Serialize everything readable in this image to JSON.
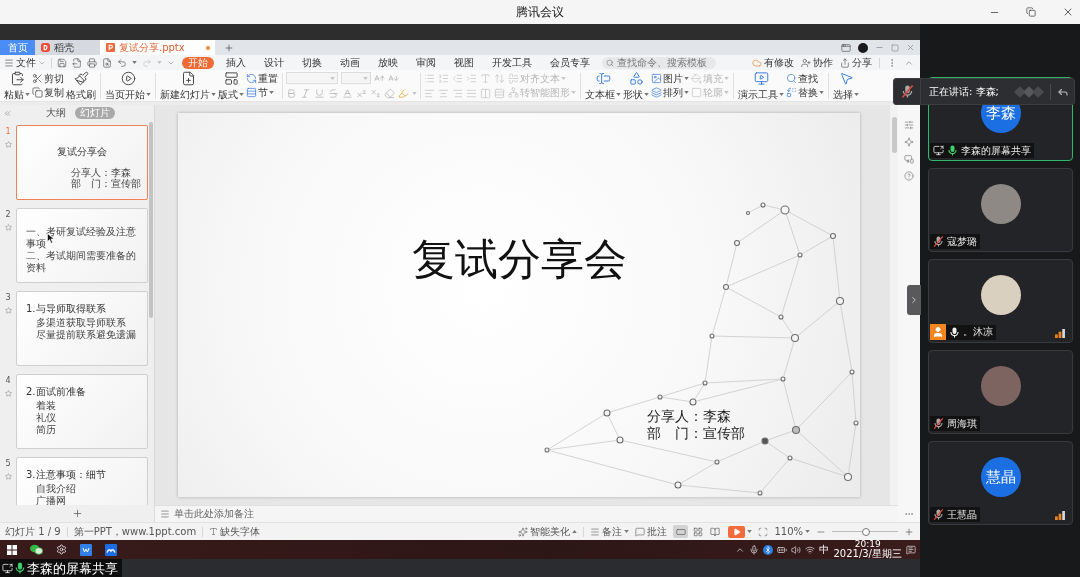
{
  "window": {
    "title": "腾讯会议"
  },
  "speaking_banner": {
    "text": "正在讲话: 李森;",
    "mic_muted": true
  },
  "wps": {
    "tabs": [
      {
        "label": "首页",
        "kind": "home",
        "selected": false,
        "unsaved": false
      },
      {
        "label": "稻壳",
        "kind": "store",
        "selected": false,
        "unsaved": false
      },
      {
        "label": "复试分享.pptx",
        "kind": "document",
        "selected": true,
        "unsaved": true
      }
    ],
    "file_menu": "文件",
    "menu_tabs": [
      {
        "label": "开始",
        "selected": true
      },
      {
        "label": "插入",
        "selected": false
      },
      {
        "label": "设计",
        "selected": false
      },
      {
        "label": "切换",
        "selected": false
      },
      {
        "label": "动画",
        "selected": false
      },
      {
        "label": "放映",
        "selected": false
      },
      {
        "label": "审阅",
        "selected": false
      },
      {
        "label": "视图",
        "selected": false
      },
      {
        "label": "开发工具",
        "selected": false
      },
      {
        "label": "会员专享",
        "selected": false
      }
    ],
    "search": {
      "placeholder": "查找命令、搜索模板"
    },
    "actions": {
      "changes": "有修改",
      "collaborate": "协作",
      "share": "分享"
    },
    "ribbon": {
      "paste": {
        "label": "粘贴",
        "dropdown": true,
        "disabled": false
      },
      "cut": {
        "label": "剪切",
        "dropdown": false,
        "disabled": false
      },
      "copy": {
        "label": "复制",
        "dropdown": false,
        "disabled": false
      },
      "format_painter": {
        "label": "格式刷",
        "dropdown": false,
        "disabled": false
      },
      "play_from_current": {
        "label": "当页开始",
        "dropdown": true,
        "disabled": false
      },
      "new_slide": {
        "label": "新建幻灯片",
        "dropdown": true,
        "disabled": false
      },
      "layout": {
        "label": "版式",
        "dropdown": true,
        "disabled": false
      },
      "reset": {
        "label": "重置",
        "dropdown": false,
        "disabled": false
      },
      "section": {
        "label": "节",
        "dropdown": true,
        "disabled": false
      },
      "font_controls": {
        "disabled": true
      },
      "paragraph_controls": {
        "disabled": true
      },
      "align_text": {
        "label": "对齐文本",
        "dropdown": true,
        "disabled": true
      },
      "smartart": {
        "label": "转智能图形",
        "dropdown": true,
        "disabled": true
      },
      "text_box": {
        "label": "文本框",
        "dropdown": true,
        "disabled": false
      },
      "shapes": {
        "label": "形状",
        "dropdown": true,
        "disabled": false
      },
      "picture": {
        "label": "图片",
        "dropdown": true,
        "disabled": false
      },
      "arrange": {
        "label": "排列",
        "dropdown": true,
        "disabled": false
      },
      "fill": {
        "label": "填充",
        "dropdown": true,
        "disabled": true
      },
      "outline": {
        "label": "轮廓",
        "dropdown": true,
        "disabled": true
      },
      "presentation_tools": {
        "label": "演示工具",
        "dropdown": true,
        "disabled": false
      },
      "find": {
        "label": "查找",
        "dropdown": false,
        "disabled": false
      },
      "replace": {
        "label": "替换",
        "dropdown": true,
        "disabled": false
      },
      "select": {
        "label": "选择",
        "dropdown": true,
        "disabled": false
      }
    },
    "panel": {
      "tabs": [
        {
          "label": "大纲",
          "selected": false
        },
        {
          "label": "幻灯片",
          "selected": true
        }
      ],
      "slides": [
        {
          "number": "1",
          "selected": true,
          "animated": true,
          "pointer": false,
          "kind": "cover",
          "title": "复试分享会",
          "lines": [
            "分享人：李森",
            "部　门：宣传部"
          ]
        },
        {
          "number": "2",
          "selected": false,
          "animated": true,
          "pointer": true,
          "kind": "list",
          "lines": [
            "一、考研复试经验及注意事项",
            "二、考试期间需要准备的资料"
          ]
        },
        {
          "number": "3",
          "selected": false,
          "animated": true,
          "pointer": false,
          "kind": "list",
          "title": "1.与导师取得联系",
          "lines": [
            "多渠道获取导师联系",
            "尽量提前联系避免遗漏"
          ]
        },
        {
          "number": "4",
          "selected": false,
          "animated": true,
          "pointer": false,
          "kind": "list",
          "title": "2.面试前准备",
          "lines": [
            "着装",
            "礼仪",
            "简历"
          ]
        },
        {
          "number": "5",
          "selected": false,
          "animated": true,
          "pointer": false,
          "kind": "list",
          "title": "3.注意事项：细节",
          "lines": [
            "自我介绍",
            "广播网"
          ]
        }
      ]
    },
    "slide": {
      "title": "复试分享会",
      "lines": [
        "分享人：李森",
        "部　门：宣传部"
      ]
    },
    "notes": {
      "placeholder": "单击此处添加备注"
    },
    "status_bar": {
      "slide_count": "幻灯片 1 / 9",
      "template": "第一PPT，www.1ppt.com",
      "missing_fonts": "缺失字体",
      "beautify": "智能美化",
      "notes": "备注",
      "comments": "批注",
      "views": [
        {
          "kind": "normal",
          "selected": true
        },
        {
          "kind": "sorter",
          "selected": false
        },
        {
          "kind": "reading",
          "selected": false
        }
      ],
      "zoom": "110%",
      "zoom_slider": {
        "level": 0.52
      }
    }
  },
  "taskbar": {
    "input_method": "中",
    "time": "20:19",
    "date": "2021/3/星期三"
  },
  "share_label": {
    "text": "李森的屏幕共享",
    "muted": false
  },
  "participants": [
    {
      "name": "李森的屏幕共享",
      "avatar": {
        "kind": "initials",
        "text": "李森"
      },
      "active": true,
      "sharing": true,
      "muted": false,
      "speaking": true,
      "host": false,
      "signal": false
    },
    {
      "name": "寇梦璐",
      "avatar": {
        "kind": "photo"
      },
      "active": false,
      "sharing": false,
      "muted": true,
      "speaking": false,
      "host": false,
      "signal": false
    },
    {
      "name": "。沐凉",
      "avatar": {
        "kind": "photo"
      },
      "active": false,
      "sharing": false,
      "muted": false,
      "speaking": false,
      "host": true,
      "signal": true
    },
    {
      "name": "周海琪",
      "avatar": {
        "kind": "photo"
      },
      "active": false,
      "sharing": false,
      "muted": true,
      "speaking": false,
      "host": false,
      "signal": false
    },
    {
      "name": "王慧晶",
      "avatar": {
        "kind": "initials",
        "text": "慧晶"
      },
      "active": false,
      "sharing": false,
      "muted": true,
      "speaking": false,
      "host": false,
      "signal": true
    }
  ]
}
